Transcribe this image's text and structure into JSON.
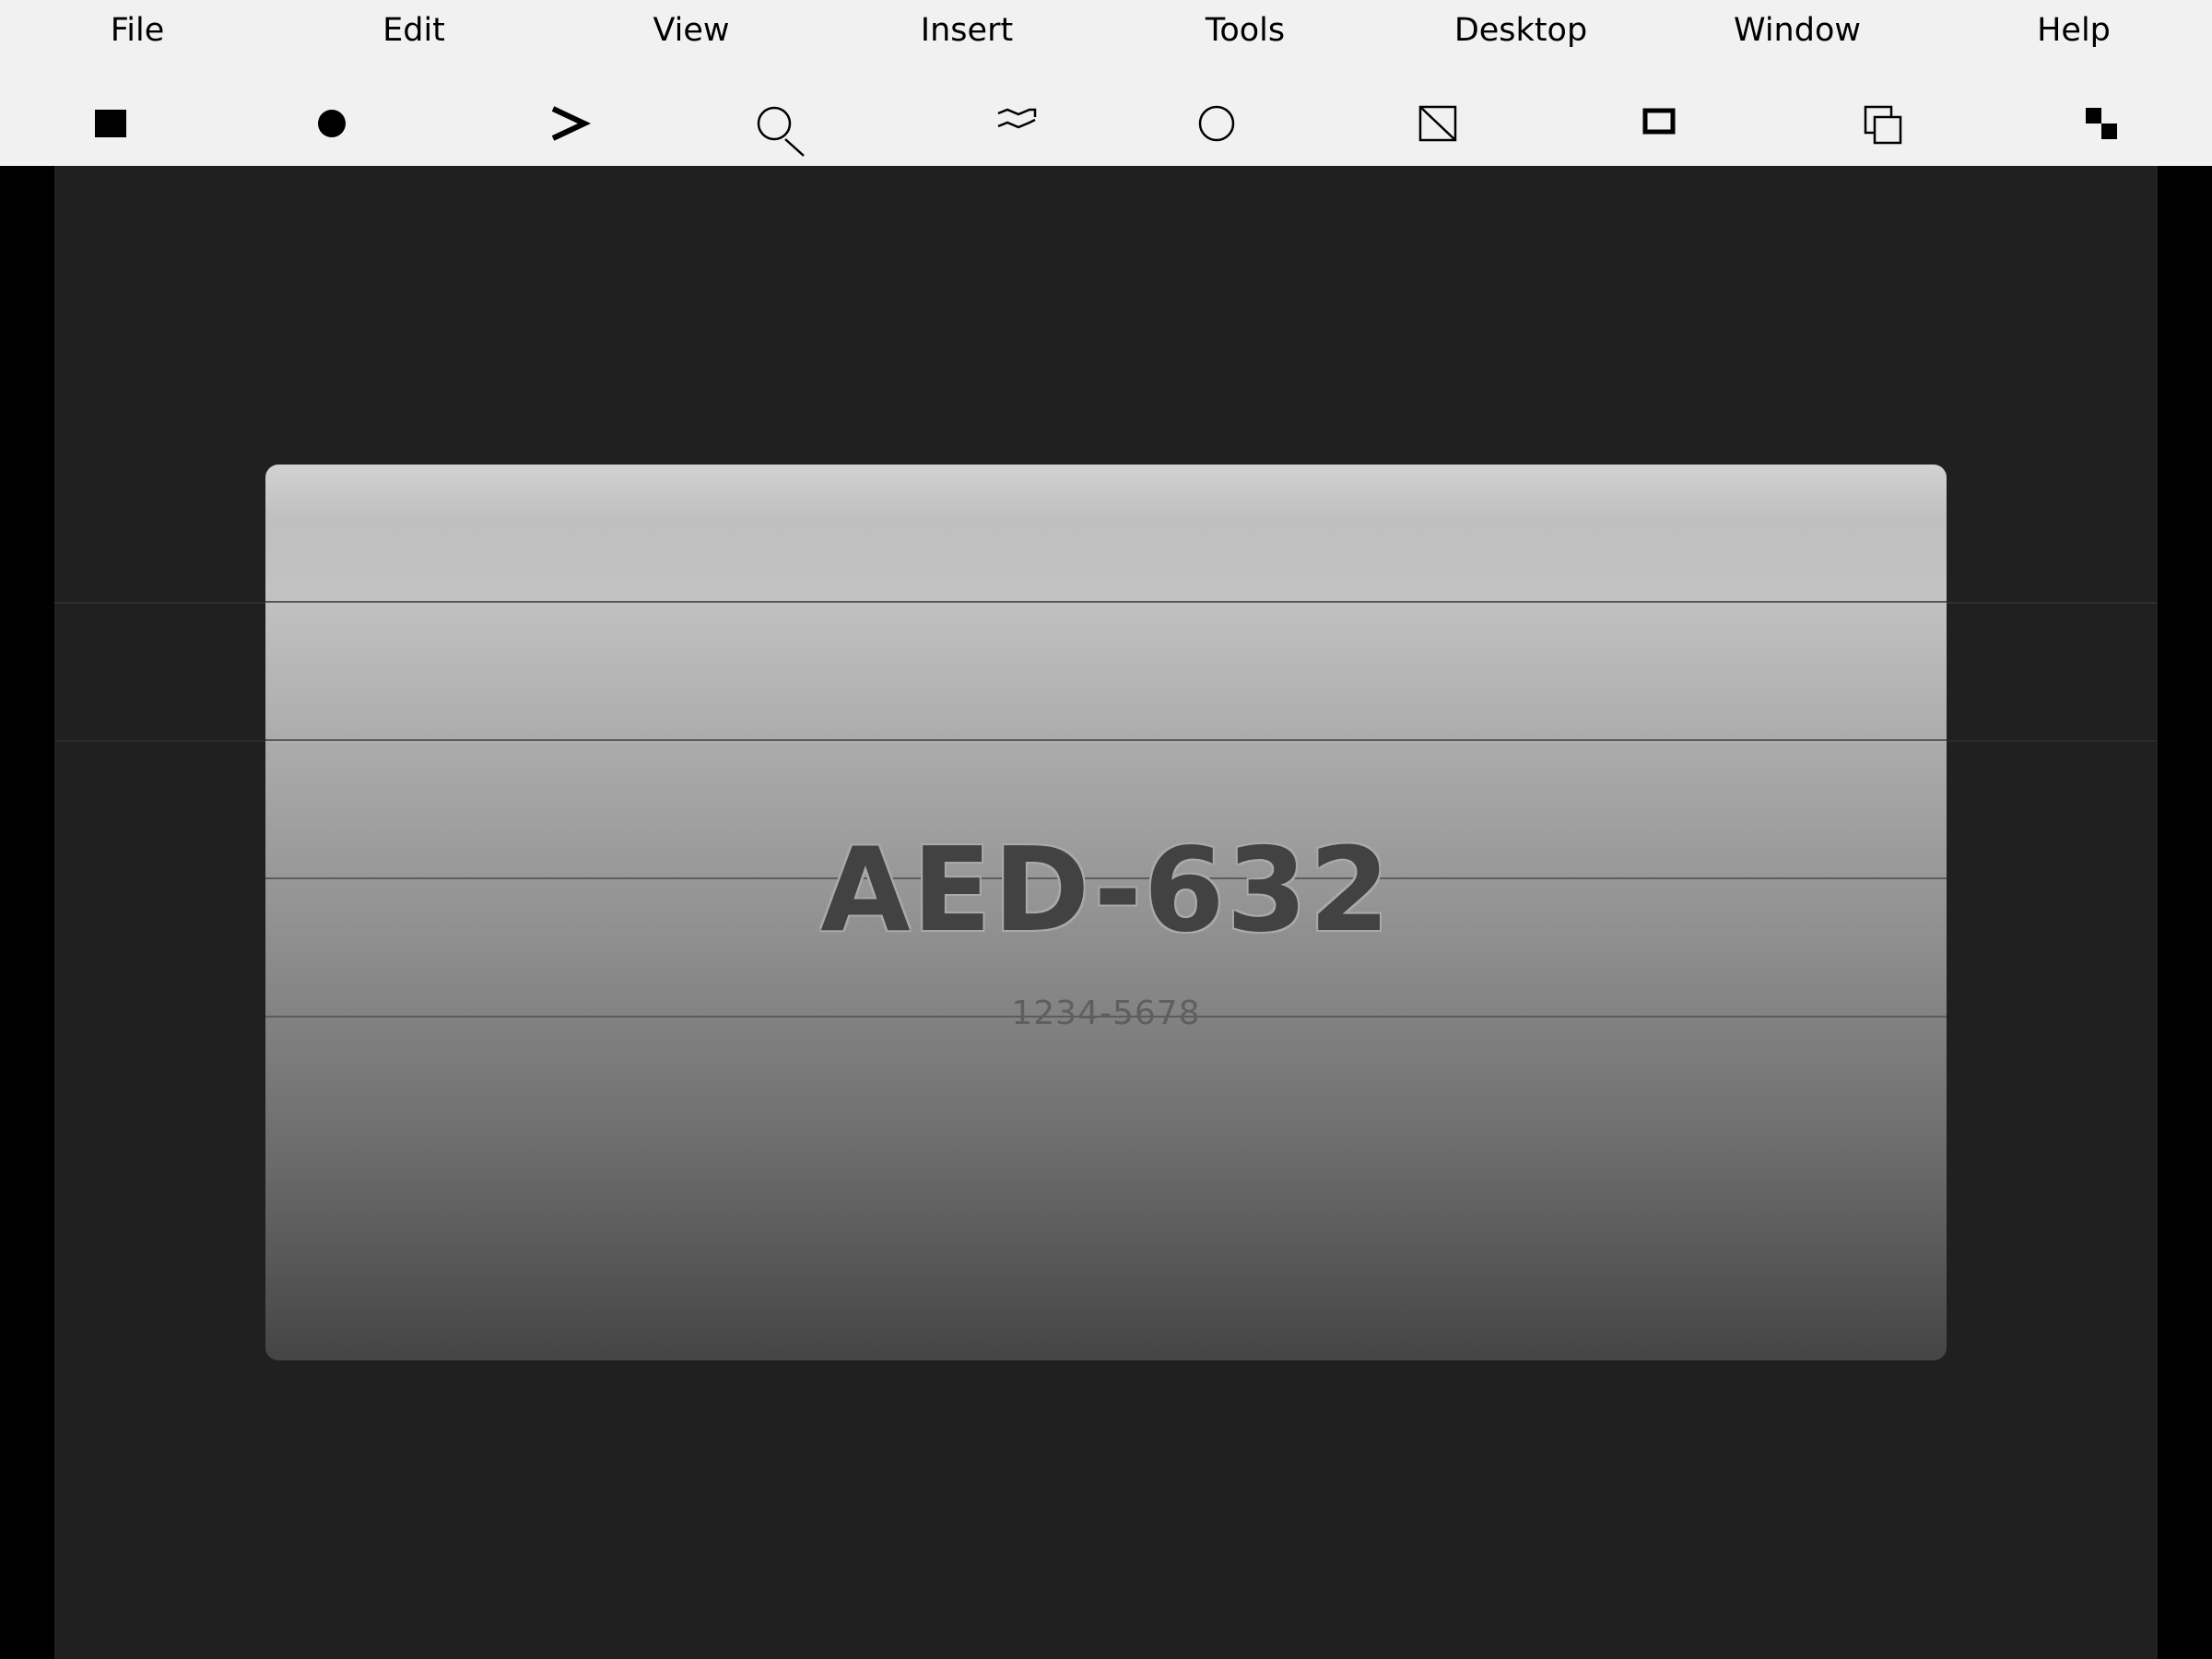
{
  "menubar": {
    "items": [
      {
        "label": "File"
      },
      {
        "label": "Edit"
      },
      {
        "label": "View"
      },
      {
        "label": "Insert"
      },
      {
        "label": "Tools"
      },
      {
        "label": "Desktop"
      },
      {
        "label": "Window"
      },
      {
        "label": "Help"
      }
    ]
  },
  "toolbar": {
    "tools": [
      {
        "icon": "filled-square-icon"
      },
      {
        "icon": "filled-circle-icon"
      },
      {
        "icon": "chevron-right-icon"
      },
      {
        "icon": "magnifier-icon"
      },
      {
        "icon": "wave-icon"
      },
      {
        "icon": "circle-outline-icon"
      },
      {
        "icon": "square-diagonal-icon"
      },
      {
        "icon": "thick-square-icon"
      },
      {
        "icon": "overlapping-squares-icon"
      },
      {
        "icon": "checker-squares-icon"
      }
    ]
  },
  "plate": {
    "title": "AED-632",
    "subtitle": "1234-5678"
  },
  "colors": {
    "menubar_bg": "#f1f1f1",
    "figure_bg": "#000000",
    "axes_bg": "#202020",
    "plate_top": "#d2d2d2",
    "plate_bottom": "#454545",
    "plate_text": "#424242",
    "plate_subtext": "#5f5f5f",
    "line_color": "#555555"
  }
}
